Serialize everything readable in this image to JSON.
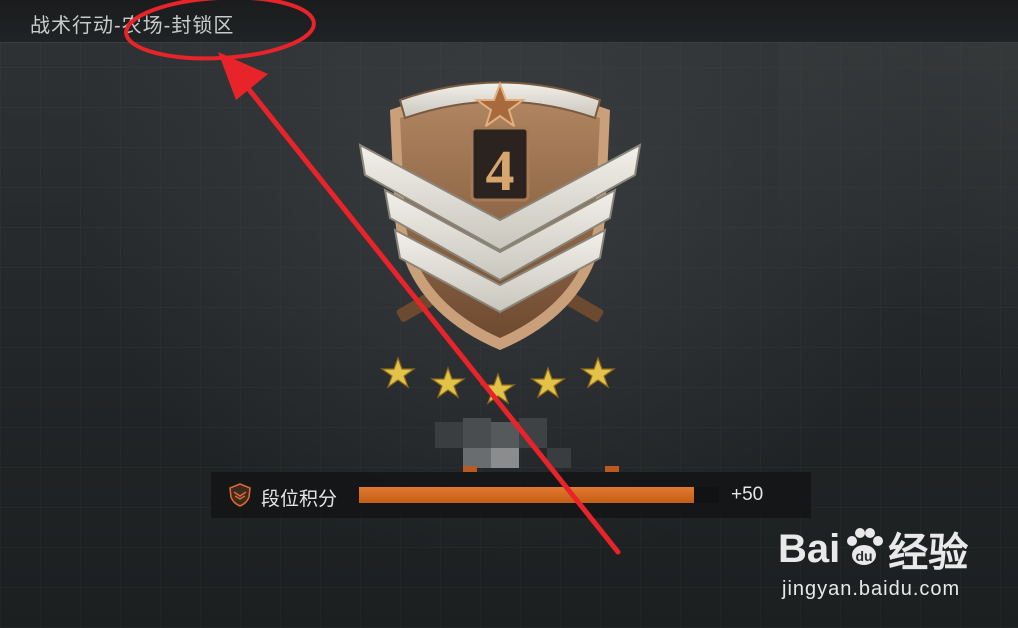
{
  "header": {
    "map_title": "战术行动-农场-封锁区"
  },
  "rank": {
    "badge_number": "4",
    "stars_filled": 5
  },
  "score": {
    "label": "段位积分",
    "delta": "+50",
    "progress_fraction": 0.93
  },
  "colors": {
    "accent_orange": "#d9692a",
    "annotation_red": "#e8242a",
    "badge_bronze": "#9a6a44",
    "star_gold": "#e3c24a"
  },
  "watermark": {
    "brand_left": "Bai",
    "brand_right": "经验",
    "url": "jingyan.baidu.com"
  }
}
